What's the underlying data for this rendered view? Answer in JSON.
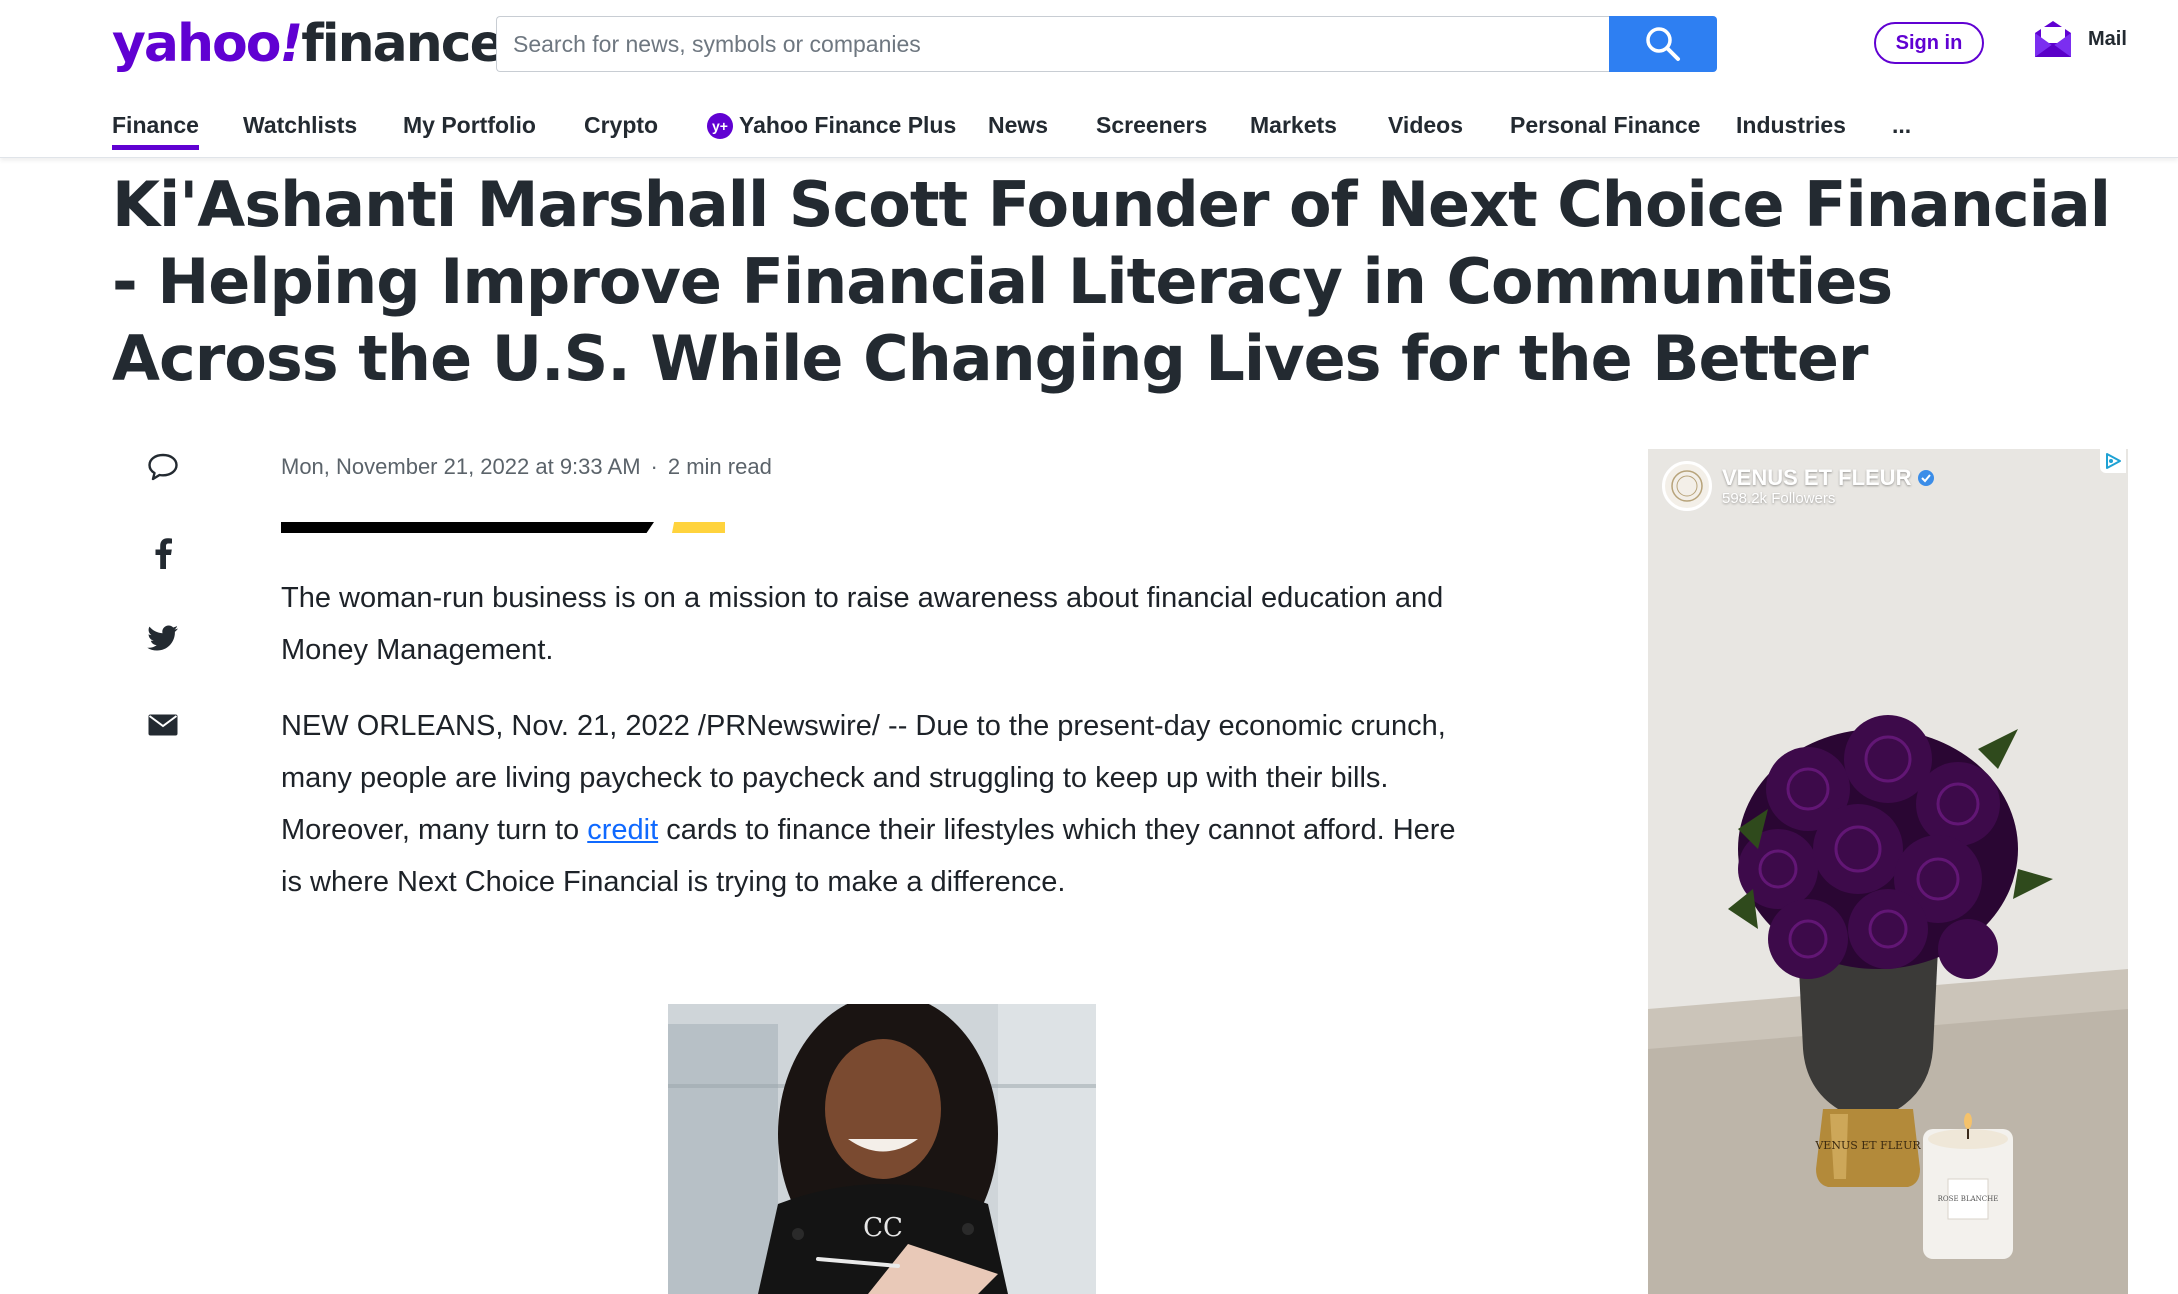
{
  "header": {
    "logo": {
      "part1": "yahoo",
      "part2": "!",
      "part3": "finance"
    },
    "search_placeholder": "Search for news, symbols or companies",
    "signin_label": "Sign in",
    "mail_label": "Mail"
  },
  "nav": {
    "items": [
      {
        "label": "Finance"
      },
      {
        "label": "Watchlists"
      },
      {
        "label": "My Portfolio"
      },
      {
        "label": "Crypto"
      },
      {
        "label": "Yahoo Finance Plus",
        "badge": "y+"
      },
      {
        "label": "News"
      },
      {
        "label": "Screeners"
      },
      {
        "label": "Markets"
      },
      {
        "label": "Videos"
      },
      {
        "label": "Personal Finance"
      },
      {
        "label": "Industries"
      },
      {
        "label": "..."
      }
    ],
    "active": "Finance"
  },
  "article": {
    "headline": "Ki'Ashanti Marshall Scott Founder of Next Choice Financial - Helping Improve Financial Literacy in Communities Across the U.S. While Changing Lives for the Better",
    "date": "Mon, November 21, 2022 at 9:33 AM",
    "read_time": "2 min read",
    "meta_separator": "·",
    "summary": "The woman-run business is on a mission to raise awareness about financial education and Money Management.",
    "body_before_link": "NEW ORLEANS, Nov. 21, 2022 /PRNewswire/ -- Due to the present-day economic crunch, many people are living paycheck to paycheck and struggling to keep up with their bills. Moreover, many turn to ",
    "body_link": "credit",
    "body_after_link": " cards to finance their lifestyles which they cannot afford. Here is where Next Choice Financial is trying to make a difference."
  },
  "share": [
    "comment-icon",
    "facebook-icon",
    "twitter-icon",
    "mail-icon"
  ],
  "ad": {
    "brand": "VENUS ET FLEUR",
    "followers": "598.2k Followers",
    "vase_text": "VENUS ET FLEUR",
    "candle_text": "ROSE BLANCHE"
  },
  "colors": {
    "brand_purple": "#6001d2",
    "search_blue": "#2e7ff2",
    "link_blue": "#0f69ff",
    "accent_yellow": "#ffd33d"
  }
}
